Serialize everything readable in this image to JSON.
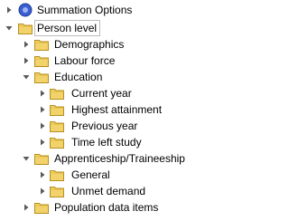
{
  "tree": {
    "summation": {
      "label": "Summation Options",
      "icon": "info-icon"
    },
    "person_level": {
      "label": "Person level",
      "expanded": true,
      "selected": true
    },
    "demographics": {
      "label": "Demographics",
      "expanded": false
    },
    "labour_force": {
      "label": "Labour force",
      "expanded": false
    },
    "education": {
      "label": "Education",
      "expanded": true,
      "children": {
        "current_year": "Current year",
        "highest_attainment": "Highest attainment",
        "previous_year": "Previous year",
        "time_left_study": "Time left study"
      }
    },
    "apprenticeship": {
      "label": "Apprenticeship/Traineeship",
      "expanded": true,
      "children": {
        "general": "General",
        "unmet_demand": "Unmet demand"
      }
    },
    "population_data_items": {
      "label": "Population data items",
      "expanded": false
    }
  },
  "colors": {
    "folder_fill": "#f2d36b",
    "folder_edge": "#b58f1c",
    "arrow": "#5a5a5a",
    "info_blue": "#2a4fbf"
  }
}
